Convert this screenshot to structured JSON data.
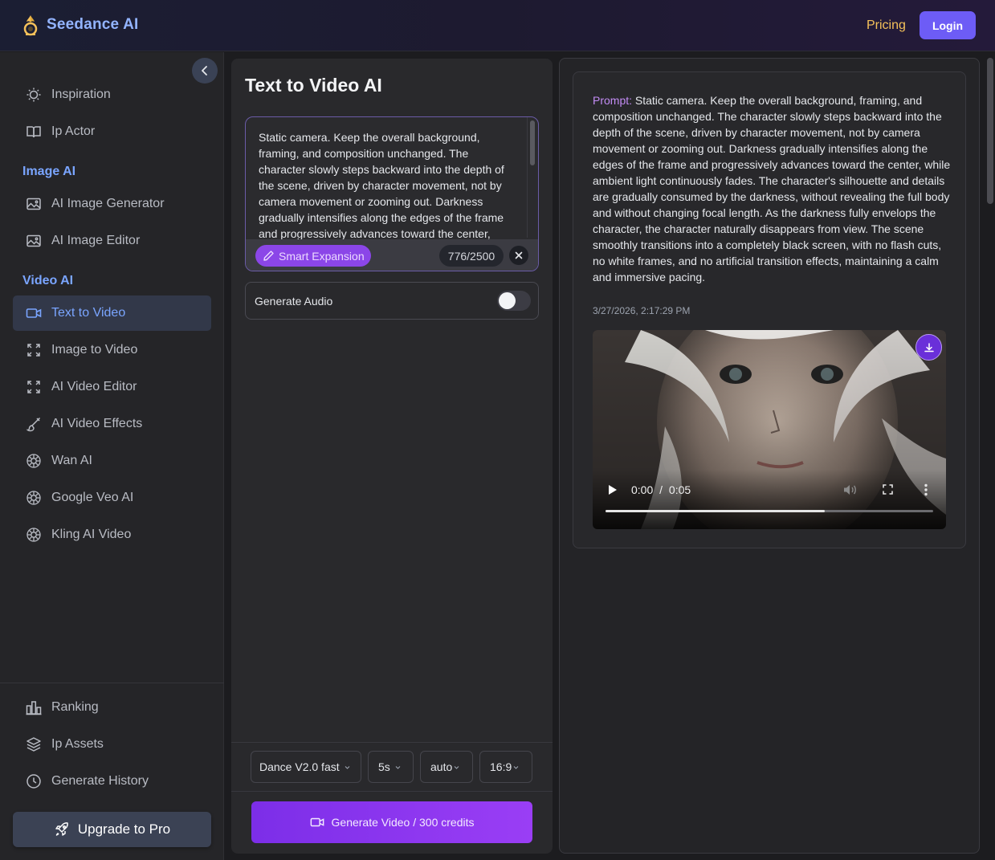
{
  "header": {
    "app_name": "Seedance AI",
    "pricing_label": "Pricing",
    "login_label": "Login"
  },
  "sidebar": {
    "top_items": [
      {
        "label": "Inspiration",
        "icon": "lightbulb-icon"
      },
      {
        "label": "Ip Actor",
        "icon": "book-icon"
      }
    ],
    "image_section": {
      "title": "Image AI",
      "items": [
        {
          "label": "AI Image Generator",
          "icon": "image-icon"
        },
        {
          "label": "AI Image Editor",
          "icon": "image-icon"
        }
      ]
    },
    "video_section": {
      "title": "Video AI",
      "items": [
        {
          "label": "Text to Video",
          "icon": "video-icon",
          "active": true
        },
        {
          "label": "Image to Video",
          "icon": "expand-icon"
        },
        {
          "label": "AI Video Editor",
          "icon": "expand-icon"
        },
        {
          "label": "AI Video Effects",
          "icon": "brush-icon"
        },
        {
          "label": "Wan AI",
          "icon": "aperture-icon"
        },
        {
          "label": "Google Veo AI",
          "icon": "aperture-icon"
        },
        {
          "label": "Kling AI Video",
          "icon": "aperture-icon"
        }
      ]
    },
    "bottom_items": [
      {
        "label": "Ranking",
        "icon": "bar-chart-icon"
      },
      {
        "label": "Ip Assets",
        "icon": "layers-icon"
      },
      {
        "label": "Generate History",
        "icon": "clock-icon"
      }
    ],
    "upgrade_label": "Upgrade to Pro"
  },
  "editor": {
    "title": "Text to Video AI",
    "prompt": "Static camera. Keep the overall background, framing, and composition unchanged. The character slowly steps backward into the depth of the scene, driven by character movement, not by camera movement or zooming out. Darkness gradually intensifies along the edges of the frame and progressively advances toward the center, while ambient light continuously fades.",
    "smart_expansion_label": "Smart Expansion",
    "char_count": "776/2500",
    "generate_audio_label": "Generate Audio",
    "generate_audio_on": false,
    "options": {
      "model": "Dance V2.0 fast",
      "duration": "5s",
      "resolution": "auto",
      "aspect_ratio": "16:9"
    },
    "generate_label": "Generate Video / 300 credits"
  },
  "result": {
    "prompt_label": "Prompt:",
    "prompt_text": "Static camera. Keep the overall background, framing, and composition unchanged. The character slowly steps backward into the depth of the scene, driven by character movement, not by camera movement or zooming out. Darkness gradually intensifies along the edges of the frame and progressively advances toward the center, while ambient light continuously fades. The character's silhouette and details are gradually consumed by the darkness, without revealing the full body and without changing focal length. As the darkness fully envelops the character, the character naturally disappears from view. The scene smoothly transitions into a completely black screen, with no flash cuts, no white frames, and no artificial transition effects, maintaining a calm and immersive pacing.",
    "timestamp": "3/27/2026, 2:17:29 PM",
    "video": {
      "current_time": "0:00",
      "separator": "/",
      "duration": "0:05",
      "buffered_fraction": 0.67
    }
  },
  "colors": {
    "accent_blue": "#7aa5ff",
    "accent_purple": "#8b46e8",
    "pricing": "#f5c15a",
    "login": "#6d5cf6"
  }
}
